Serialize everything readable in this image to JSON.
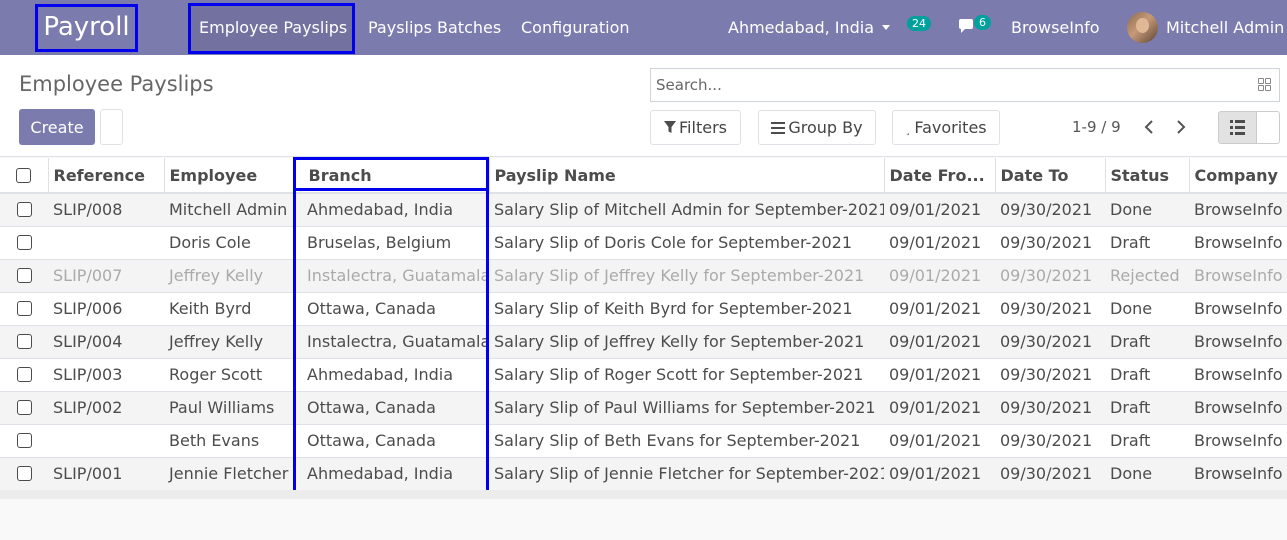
{
  "nav": {
    "app_name": "Payroll",
    "menu": [
      "Employee Payslips",
      "Payslips Batches",
      "Configuration"
    ],
    "branch_selector": "Ahmedabad, India",
    "activity_count": "24",
    "message_count": "6",
    "company": "BrowseInfo",
    "user": "Mitchell Admin"
  },
  "control_panel": {
    "title": "Employee Payslips",
    "create_label": "Create",
    "search_placeholder": "Search...",
    "filters_label": "Filters",
    "group_by_label": "Group By",
    "favorites_label": "Favorites",
    "pager": "1-9 / 9"
  },
  "table": {
    "columns": [
      "Reference",
      "Employee",
      "Branch",
      "Payslip Name",
      "Date Fro...",
      "Date To",
      "Status",
      "Company"
    ],
    "rows": [
      {
        "reference": "SLIP/008",
        "employee": "Mitchell Admin",
        "branch": "Ahmedabad, India",
        "payslip_name": "Salary Slip of Mitchell Admin for September-2021",
        "date_from": "09/01/2021",
        "date_to": "09/30/2021",
        "status": "Done",
        "company": "BrowseInfo"
      },
      {
        "reference": "",
        "employee": "Doris Cole",
        "branch": "Bruselas, Belgium",
        "payslip_name": "Salary Slip of Doris Cole for September-2021",
        "date_from": "09/01/2021",
        "date_to": "09/30/2021",
        "status": "Draft",
        "company": "BrowseInfo"
      },
      {
        "reference": "SLIP/007",
        "employee": "Jeffrey Kelly",
        "branch": "Instalectra, Guatamala",
        "payslip_name": "Salary Slip of Jeffrey Kelly for September-2021",
        "date_from": "09/01/2021",
        "date_to": "09/30/2021",
        "status": "Rejected",
        "company": "BrowseInfo"
      },
      {
        "reference": "SLIP/006",
        "employee": "Keith Byrd",
        "branch": "Ottawa, Canada",
        "payslip_name": "Salary Slip of Keith Byrd for September-2021",
        "date_from": "09/01/2021",
        "date_to": "09/30/2021",
        "status": "Done",
        "company": "BrowseInfo"
      },
      {
        "reference": "SLIP/004",
        "employee": "Jeffrey Kelly",
        "branch": "Instalectra, Guatamala",
        "payslip_name": "Salary Slip of Jeffrey Kelly for September-2021",
        "date_from": "09/01/2021",
        "date_to": "09/30/2021",
        "status": "Draft",
        "company": "BrowseInfo"
      },
      {
        "reference": "SLIP/003",
        "employee": "Roger Scott",
        "branch": "Ahmedabad, India",
        "payslip_name": "Salary Slip of Roger Scott for September-2021",
        "date_from": "09/01/2021",
        "date_to": "09/30/2021",
        "status": "Draft",
        "company": "BrowseInfo"
      },
      {
        "reference": "SLIP/002",
        "employee": "Paul Williams",
        "branch": "Ottawa, Canada",
        "payslip_name": "Salary Slip of Paul Williams for September-2021",
        "date_from": "09/01/2021",
        "date_to": "09/30/2021",
        "status": "Draft",
        "company": "BrowseInfo"
      },
      {
        "reference": "",
        "employee": "Beth Evans",
        "branch": "Ottawa, Canada",
        "payslip_name": "Salary Slip of Beth Evans for September-2021",
        "date_from": "09/01/2021",
        "date_to": "09/30/2021",
        "status": "Draft",
        "company": "BrowseInfo"
      },
      {
        "reference": "SLIP/001",
        "employee": "Jennie Fletcher",
        "branch": "Ahmedabad, India",
        "payslip_name": "Salary Slip of Jennie Fletcher for September-2021",
        "date_from": "09/01/2021",
        "date_to": "09/30/2021",
        "status": "Done",
        "company": "BrowseInfo"
      }
    ]
  },
  "colors": {
    "navbar": "#7c7bad",
    "highlight": "#0000ee",
    "badge": "#00a09d",
    "muted_row_text": "#aaaaaa"
  },
  "icons": [
    "chat-icon",
    "funnel-icon",
    "list-lines-icon",
    "star-icon",
    "chevron-left-icon",
    "chevron-right-icon",
    "list-view-icon",
    "grid-icon"
  ]
}
